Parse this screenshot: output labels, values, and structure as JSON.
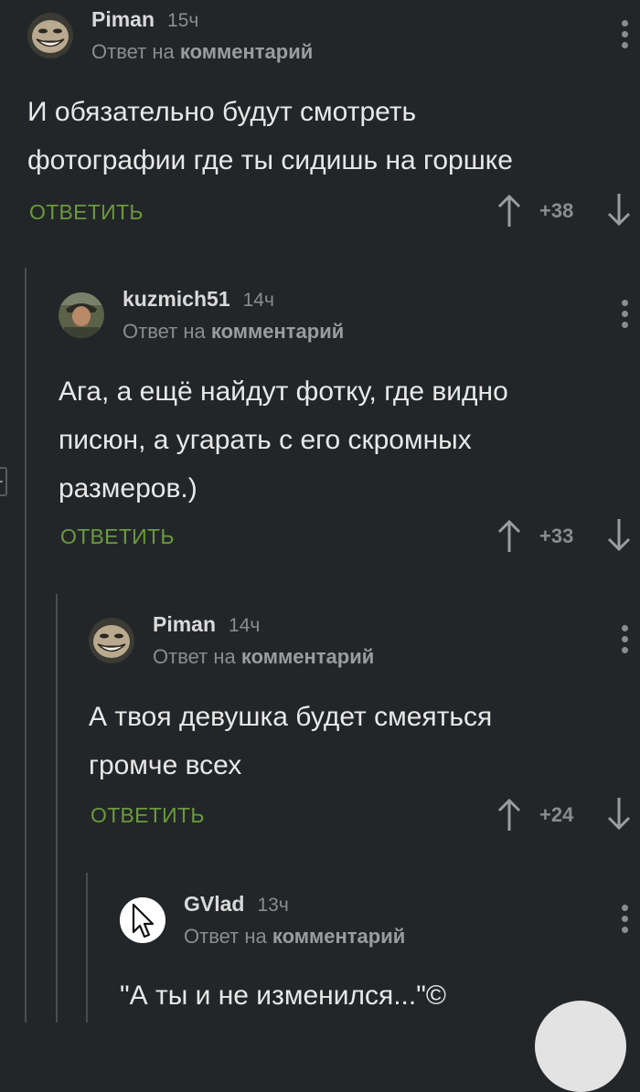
{
  "comments": [
    {
      "username": "Piman",
      "time": "15ч",
      "reply_prefix": "Ответ на",
      "reply_target": "комментарий",
      "lines": [
        "И обязательно будут смотреть",
        "фотографии где ты сидишь на горшке"
      ],
      "reply_label": "ОТВЕТИТЬ",
      "score": "+38",
      "avatar": "troll-face-icon"
    },
    {
      "username": "kuzmich51",
      "time": "14ч",
      "reply_prefix": "Ответ на",
      "reply_target": "комментарий",
      "lines": [
        "Ага, а ещё найдут фотку, где видно",
        "писюн, а угарать с его скромных",
        "размеров.)"
      ],
      "reply_label": "ОТВЕТИТЬ",
      "score": "+33",
      "avatar": "bearded-man-photo"
    },
    {
      "username": "Piman",
      "time": "14ч",
      "reply_prefix": "Ответ на",
      "reply_target": "комментарий",
      "lines": [
        "А твоя девушка будет смеяться",
        "громче всех"
      ],
      "reply_label": "ОТВЕТИТЬ",
      "score": "+24",
      "avatar": "troll-face-icon"
    },
    {
      "username": "GVlad",
      "time": "13ч",
      "reply_prefix": "Ответ на",
      "reply_target": "комментарий",
      "lines": [
        "\"А ты и не изменился...\"©"
      ],
      "avatar": "mouse-cursor-icon"
    }
  ],
  "colors": {
    "background": "#232629",
    "reply_button": "#6a9a3d",
    "thread_line": "#4a4d50"
  }
}
